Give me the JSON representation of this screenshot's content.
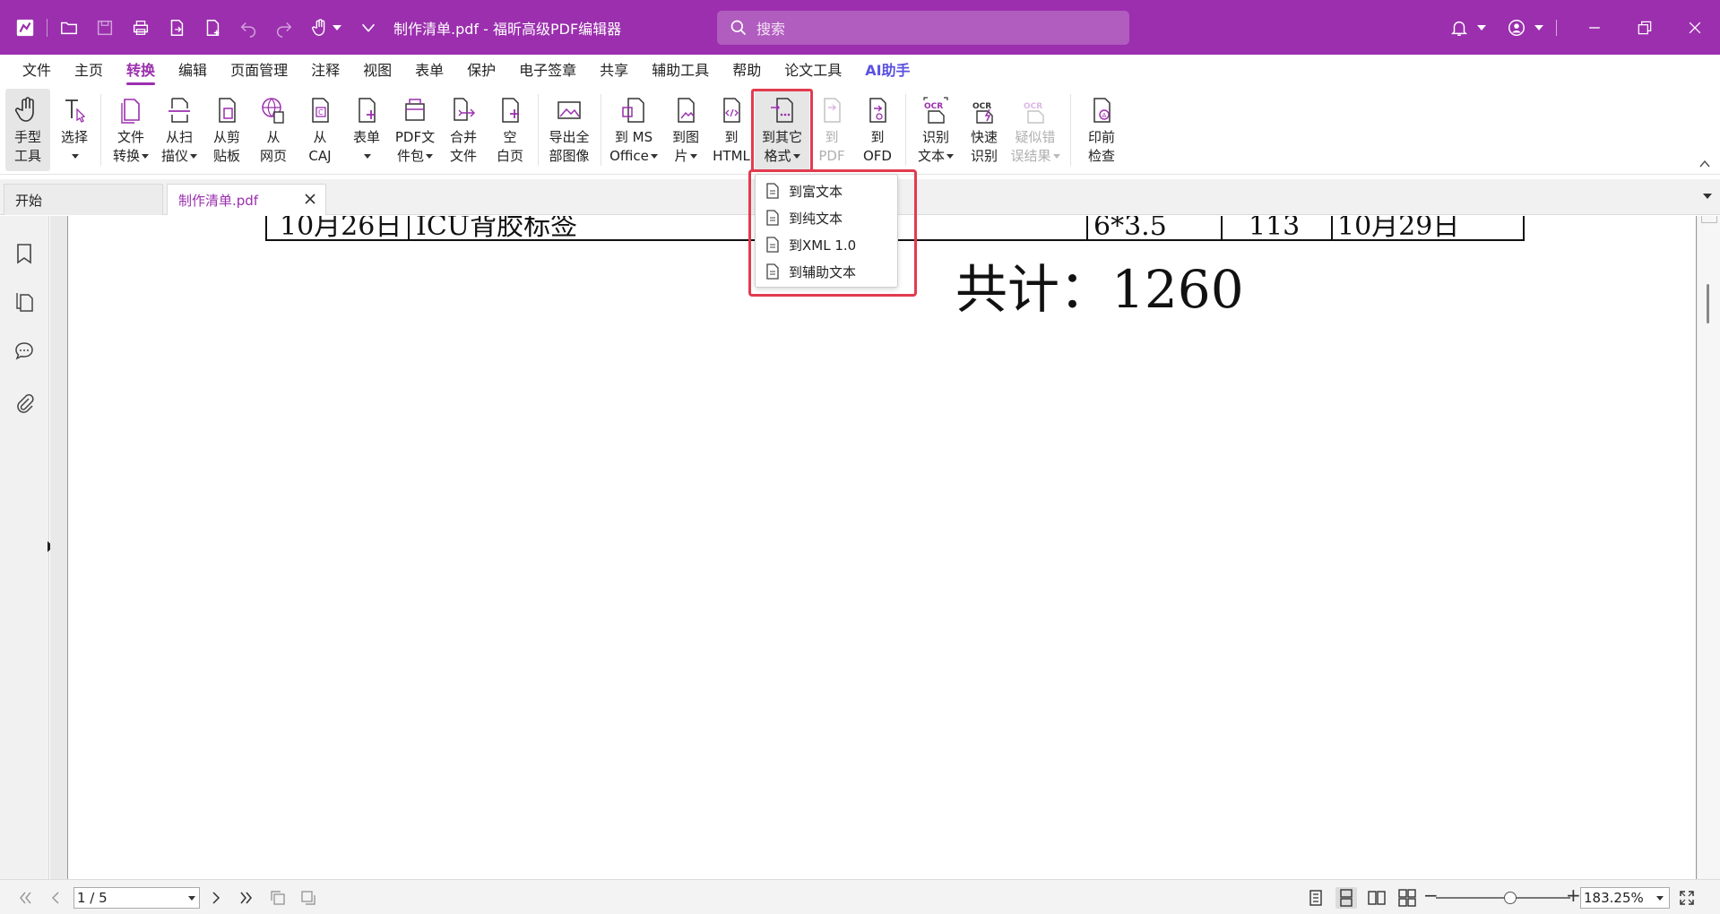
{
  "app": {
    "title": "制作清单.pdf - 福昕高级PDF编辑器",
    "search_placeholder": "搜索",
    "brand_color": "#9b2fae",
    "highlight_color": "#e23b4e"
  },
  "quick_access": [
    "app-logo-icon",
    "open-icon",
    "save-icon",
    "print-icon",
    "export-icon",
    "new-icon",
    "undo-icon",
    "redo-icon",
    "hand-icon",
    "customize-icon"
  ],
  "menu": [
    {
      "label": "文件"
    },
    {
      "label": "主页"
    },
    {
      "label": "转换",
      "active": true
    },
    {
      "label": "编辑"
    },
    {
      "label": "页面管理"
    },
    {
      "label": "注释"
    },
    {
      "label": "视图"
    },
    {
      "label": "表单"
    },
    {
      "label": "保护"
    },
    {
      "label": "电子签章"
    },
    {
      "label": "共享"
    },
    {
      "label": "辅助工具"
    },
    {
      "label": "帮助"
    },
    {
      "label": "论文工具"
    },
    {
      "label": "AI助手"
    }
  ],
  "ribbon": {
    "hand_tool": {
      "line1": "手型",
      "line2": "工具"
    },
    "select": {
      "line1": "选择",
      "line2": ""
    },
    "file_convert": {
      "line1": "文件",
      "line2": "转换"
    },
    "from_scanner": {
      "line1": "从扫",
      "line2": "描仪"
    },
    "from_clipboard": {
      "line1": "从剪",
      "line2": "贴板"
    },
    "from_web": {
      "line1": "从",
      "line2": "网页"
    },
    "from_caj": {
      "line1": "从",
      "line2": "CAJ"
    },
    "form": {
      "line1": "表单",
      "line2": ""
    },
    "pdf_package": {
      "line1": "PDF文",
      "line2": "件包"
    },
    "merge_files": {
      "line1": "合并",
      "line2": "文件"
    },
    "blank_page": {
      "line1": "空",
      "line2": "白页"
    },
    "export_images": {
      "line1": "导出全",
      "line2": "部图像"
    },
    "to_ms_office": {
      "line1": "到 MS",
      "line2": "Office"
    },
    "to_image": {
      "line1": "到图",
      "line2": "片"
    },
    "to_html": {
      "line1": "到",
      "line2": "HTML"
    },
    "to_other": {
      "line1": "到其它",
      "line2": "格式"
    },
    "to_pdf": {
      "line1": "到",
      "line2": "PDF"
    },
    "to_ofd": {
      "line1": "到",
      "line2": "OFD"
    },
    "ocr_text": {
      "line1": "识别",
      "line2": "文本"
    },
    "quick_ocr": {
      "line1": "快速",
      "line2": "识别"
    },
    "suspect_errors": {
      "line1": "疑似错",
      "line2": "误结果"
    },
    "preflight": {
      "line1": "印前",
      "line2": "检查"
    }
  },
  "dropdown": [
    {
      "label": "到富文本"
    },
    {
      "label": "到纯文本"
    },
    {
      "label": "到XML 1.0"
    },
    {
      "label": "到辅助文本"
    }
  ],
  "tabs": {
    "start": "开始",
    "file": "制作清单.pdf"
  },
  "document": {
    "row": {
      "date": "10月26日",
      "item": "ICU背胶标签",
      "size": "6*3.5",
      "qty": "113",
      "due": "10月29日"
    },
    "total": "共计：1260"
  },
  "status": {
    "page": "1 / 5",
    "zoom": "183.25%",
    "zoom_level_fraction": 0.55
  }
}
